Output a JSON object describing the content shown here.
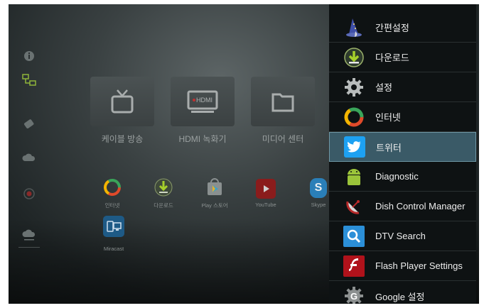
{
  "tiles": [
    {
      "label": "케이블 방송",
      "icon": "tv-icon"
    },
    {
      "label": "HDMI 녹화기",
      "icon": "hdmi-icon",
      "badge": "HDMI"
    },
    {
      "label": "미디어 센터",
      "icon": "folder-icon"
    }
  ],
  "apps": [
    {
      "label": "인터넷",
      "icon": "chrome-icon"
    },
    {
      "label": "다운로드",
      "icon": "download-icon"
    },
    {
      "label": "Play 스토어",
      "icon": "play-store-icon"
    },
    {
      "label": "YouTube",
      "icon": "youtube-icon"
    },
    {
      "label": "Skype",
      "icon": "skype-icon"
    },
    {
      "label": "Miracast",
      "icon": "miracast-icon"
    }
  ],
  "menu": {
    "items": [
      {
        "label": "간편설정",
        "icon": "wizard-icon"
      },
      {
        "label": "다운로드",
        "icon": "download-icon"
      },
      {
        "label": "설정",
        "icon": "gear-icon"
      },
      {
        "label": "인터넷",
        "icon": "chrome-icon"
      },
      {
        "label": "트위터",
        "icon": "twitter-icon",
        "selected": true
      },
      {
        "label": "Diagnostic",
        "icon": "android-icon"
      },
      {
        "label": "Dish Control Manager",
        "icon": "satellite-dish-icon"
      },
      {
        "label": "DTV Search",
        "icon": "search-icon"
      },
      {
        "label": "Flash Player Settings",
        "icon": "flash-icon"
      },
      {
        "label": "Google 설정",
        "icon": "google-settings-icon"
      }
    ]
  },
  "colors": {
    "menu_bg": "#0e1213",
    "selected_bg": "#3a5a67",
    "twitter_blue": "#1da1f2"
  }
}
